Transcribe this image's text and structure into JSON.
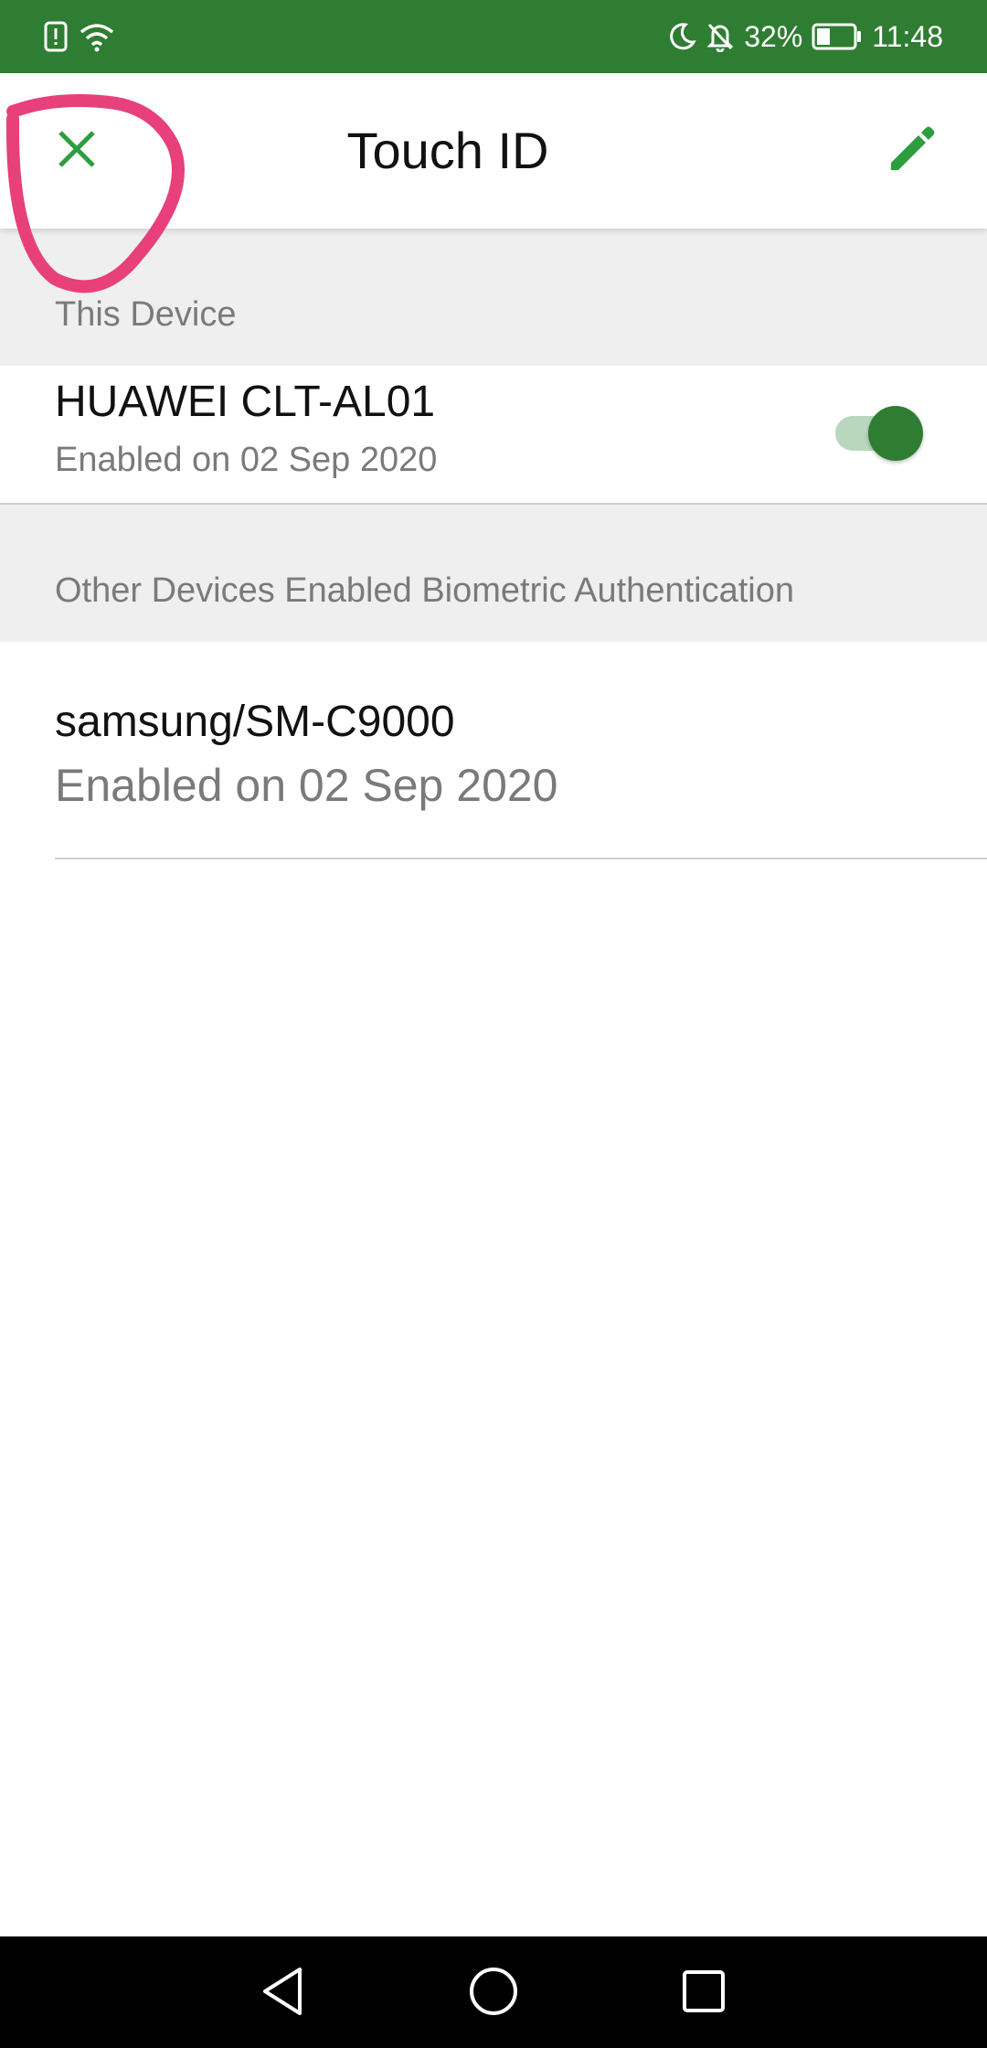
{
  "status_bar": {
    "battery": "32%",
    "time": "11:48",
    "icons": [
      "alert-icon",
      "wifi-icon",
      "moon-icon",
      "bell-off-icon",
      "battery-icon"
    ]
  },
  "app_bar": {
    "title": "Touch ID",
    "close_icon": "close-icon",
    "edit_icon": "pencil-icon"
  },
  "this_device": {
    "header": "This Device",
    "name": "HUAWEI CLT-AL01",
    "subtitle": "Enabled on 02 Sep 2020",
    "toggle_on": true
  },
  "other_devices": {
    "header": "Other Devices Enabled Biometric Authentication",
    "items": [
      {
        "name": "samsung/SM-C9000",
        "subtitle": "Enabled on 02 Sep 2020"
      }
    ]
  },
  "nav_bar": {
    "icons": [
      "back-icon",
      "home-icon",
      "recents-icon"
    ]
  },
  "colors": {
    "accent": "#2e7d32",
    "annotation": "#e8407a"
  }
}
